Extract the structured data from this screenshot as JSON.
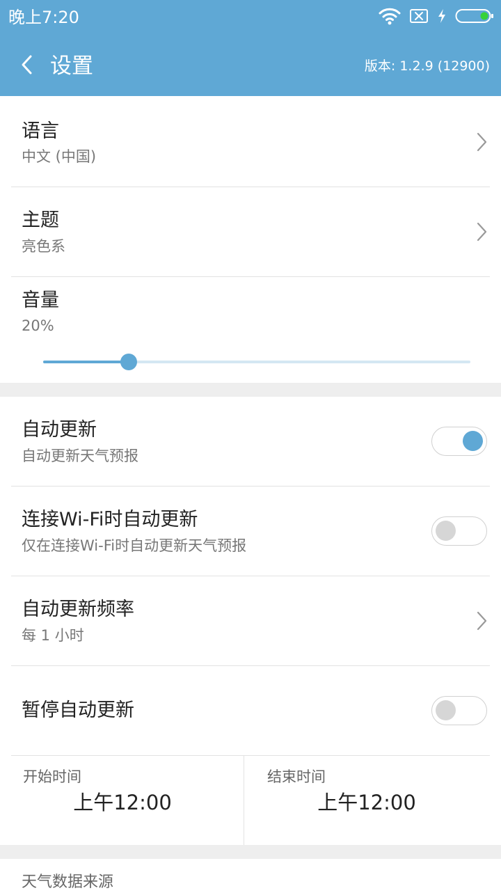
{
  "status_bar": {
    "time": "晚上7:20",
    "icons": [
      "wifi-icon",
      "no-sim-icon",
      "charging-icon",
      "battery-icon"
    ]
  },
  "toolbar": {
    "back_icon": "chevron-left-icon",
    "title": "设置",
    "version": "版本: 1.2.9 (12900)"
  },
  "colors": {
    "accent": "#5fa8d5",
    "toggle_off": "#d6d6d6",
    "divider": "#e2e2e2",
    "section_gap": "#eeeeee"
  },
  "settings": {
    "language": {
      "title": "语言",
      "value": "中文 (中国)"
    },
    "theme": {
      "title": "主题",
      "value": "亮色系"
    },
    "volume": {
      "title": "音量",
      "value_text": "20%",
      "level": 0.2
    },
    "auto_update": {
      "title": "自动更新",
      "subtitle": "自动更新天气预报",
      "enabled": true
    },
    "wifi_update": {
      "title": "连接Wi-Fi时自动更新",
      "subtitle": "仅在连接Wi-Fi时自动更新天气预报",
      "enabled": false
    },
    "update_frequency": {
      "title": "自动更新频率",
      "value": "每 1 小时"
    },
    "pause_update": {
      "title": "暂停自动更新",
      "enabled": false
    },
    "pause_start": {
      "label": "开始时间",
      "value": "上午12:00"
    },
    "pause_end": {
      "label": "结束时间",
      "value": "上午12:00"
    }
  },
  "sections": {
    "weather_source_header": "天气数据来源"
  }
}
